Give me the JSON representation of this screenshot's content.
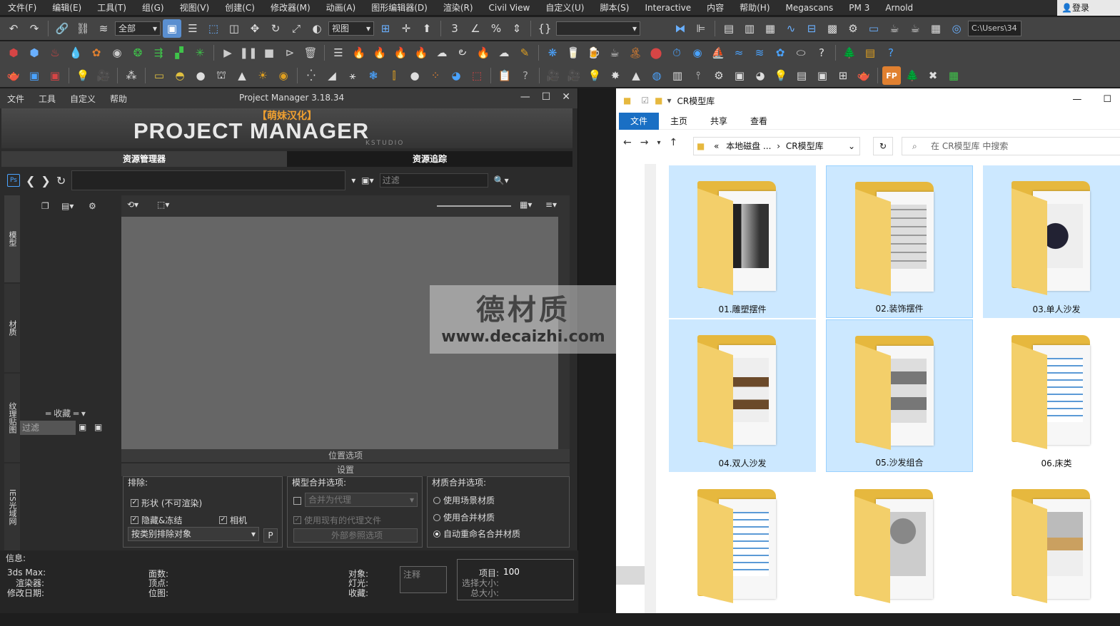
{
  "menubar": {
    "items": [
      "文件(F)",
      "编辑(E)",
      "工具(T)",
      "组(G)",
      "视图(V)",
      "创建(C)",
      "修改器(M)",
      "动画(A)",
      "图形编辑器(D)",
      "渲染(R)",
      "Civil View",
      "自定义(U)",
      "脚本(S)",
      "Interactive",
      "内容",
      "帮助(H)",
      "Megascans",
      "PM 3",
      "Arnold"
    ],
    "login": "登录"
  },
  "toolbar": {
    "selection_filter": "全部",
    "view_dropdown": "视图",
    "path_text": "C:\\Users\\34"
  },
  "pm": {
    "menu": [
      "文件",
      "工具",
      "自定义",
      "帮助"
    ],
    "title": "Project Manager 3.18.34",
    "banner_cn": "【萌妹汉化】",
    "banner_logo": "PROJECT MANAGER",
    "banner_sub": "KSTUDIO",
    "tabs": [
      "资源管理器",
      "资源追踪"
    ],
    "filter_placeholder": "过滤",
    "ps_badge": "Ps",
    "vertical_tabs": [
      "模型",
      "材质",
      "纹理贴图",
      "IES光域网"
    ],
    "favorites_label": "收藏",
    "side_filter": "过滤",
    "bar_location": "位置选项",
    "bar_settings": "设置",
    "exclude": {
      "title": "排除:",
      "shape": "形状 (不可渲染)",
      "hidden": "隐藏&冻结",
      "camera": "相机",
      "by_category": "按类别排除对象",
      "p_button": "P"
    },
    "model_merge": {
      "title": "模型合并选项:",
      "merge_proxy": "合并为代理",
      "use_existing": "使用现有的代理文件",
      "xref": "外部参照选项"
    },
    "material_merge": {
      "title": "材质合并选项:",
      "opt1": "使用场景材质",
      "opt2": "使用合并材质",
      "opt3": "自动重命名合并材质"
    },
    "info": {
      "title": "信息:",
      "max": "3ds Max:",
      "renderer": "渲染器:",
      "modified": "修改日期:",
      "faces": "面数:",
      "verts": "顶点:",
      "bitmaps": "位图:",
      "objects": "对象:",
      "lights": "灯光:",
      "favorites": "收藏:",
      "note": "注释",
      "items_label": "项目:",
      "items_value": "100",
      "sel_size": "选择大小:",
      "total_size": "总大小:"
    }
  },
  "watermark": {
    "cn": "德材质",
    "url": "www.decaizhi.com"
  },
  "explorer": {
    "title": "CR模型库",
    "ribbon": [
      "文件",
      "主页",
      "共享",
      "查看"
    ],
    "address_parts": [
      "本地磁盘 ...",
      "CR模型库"
    ],
    "address_prefix": "«",
    "search_placeholder": "在 CR模型库 中搜索",
    "folders": [
      {
        "label": "01.雕塑摆件"
      },
      {
        "label": "02.装饰摆件"
      },
      {
        "label": "03.单人沙发"
      },
      {
        "label": "04.双人沙发"
      },
      {
        "label": "05.沙发组合"
      },
      {
        "label": "06.床类"
      },
      {
        "label": ""
      },
      {
        "label": ""
      },
      {
        "label": ""
      }
    ]
  }
}
